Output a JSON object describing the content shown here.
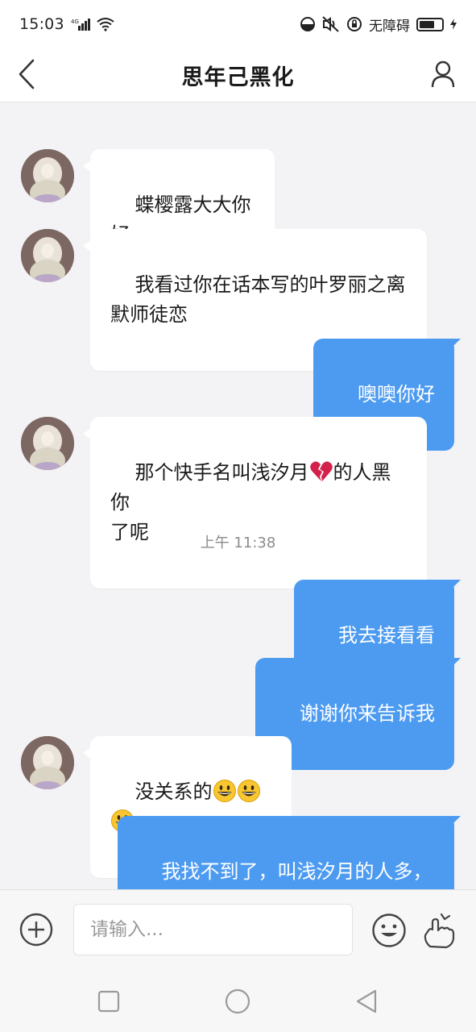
{
  "status_bar": {
    "time": "15:03",
    "network": "4G",
    "accessibility_label": "无障碍"
  },
  "header": {
    "title": "思年己黑化"
  },
  "messages": [
    {
      "side": "in",
      "text": "蝶樱露大大你好"
    },
    {
      "side": "in",
      "text": "我看过你在话本写的叶罗丽之离\n默师徒恋"
    },
    {
      "side": "out",
      "text": "噢噢你好"
    },
    {
      "side": "in",
      "text_before": "那个快手名叫浅汐月",
      "emoji": "broken-heart",
      "text_after": "的人黑你\n了呢"
    },
    {
      "side": "out",
      "text": "我去接看看"
    },
    {
      "side": "out",
      "text": "谢谢你来告诉我"
    },
    {
      "side": "in",
      "text": "没关系的",
      "emoji": "grinning-face",
      "emoji_count": 3
    },
    {
      "side": "out",
      "text": "我找不到了，叫浅汐月的人多，\n你能发快手号吗？"
    }
  ],
  "timestamp": "上午 11:38",
  "input": {
    "placeholder": "请输入..."
  },
  "colors": {
    "outgoing_bubble": "#4d9bf1",
    "incoming_bubble": "#ffffff",
    "chat_background": "#f3f3f5"
  }
}
